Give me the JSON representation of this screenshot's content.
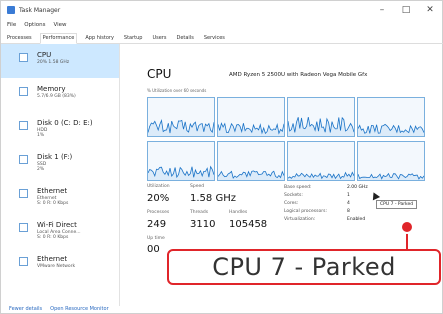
{
  "window": {
    "title": "Task Manager",
    "minimize": "–",
    "maximize": "□",
    "close": "✕"
  },
  "menu": [
    "File",
    "Options",
    "View"
  ],
  "tabs": [
    "Processes",
    "Performance",
    "App history",
    "Startup",
    "Users",
    "Details",
    "Services"
  ],
  "active_tab": "Performance",
  "sidebar": [
    {
      "name": "CPU",
      "sub": "20%  1.58 GHz"
    },
    {
      "name": "Memory",
      "sub": "5.7/6.9 GB (83%)"
    },
    {
      "name": "Disk 0 (C: D: E:)",
      "sub": "HDD\n1%"
    },
    {
      "name": "Disk 1 (F:)",
      "sub": "SSD\n2%"
    },
    {
      "name": "Ethernet",
      "sub": "Ethernet\nS: 0 R: 0 Kbps"
    },
    {
      "name": "Wi-Fi Direct",
      "sub": "Local Area Conne...\nS: 0 R: 0 Kbps"
    },
    {
      "name": "Ethernet",
      "sub": "VMware Network"
    }
  ],
  "main": {
    "title": "CPU",
    "model": "AMD Ryzen 5 2500U with Radeon Vega Mobile Gfx",
    "graphs_label": "% Utilization over 60 seconds",
    "utilization_label": "Utilization",
    "utilization_value": "20%",
    "speed_label": "Speed",
    "speed_value": "1.58 GHz",
    "processes_label": "Processes",
    "processes_value": "249",
    "threads_label": "Threads",
    "threads_value": "3110",
    "handles_label": "Handles",
    "handles_value": "105458",
    "uptime_label": "Up time",
    "uptime_value": "00",
    "right_stats": [
      {
        "label": "Base speed:",
        "value": "2.00 GHz"
      },
      {
        "label": "Sockets:",
        "value": "1"
      },
      {
        "label": "Cores:",
        "value": "4"
      },
      {
        "label": "Logical processors:",
        "value": "8"
      },
      {
        "label": "Virtualization:",
        "value": "Enabled"
      }
    ]
  },
  "tooltip": "CPU 7 - Parked",
  "callout": "CPU 7 - Parked",
  "footer": {
    "fewer_details": "Fewer details",
    "resource_monitor": "Open Resource Monitor"
  },
  "colors": {
    "graph_line": "#1a73c7",
    "graph_bg": "#f3f8fd",
    "accent_red": "#e0252a",
    "selected": "#cde8ff"
  },
  "cpu_graph_levels": [
    0.25,
    0.2,
    0.3,
    0.18,
    0.22,
    0.15,
    0.12,
    0.1
  ]
}
